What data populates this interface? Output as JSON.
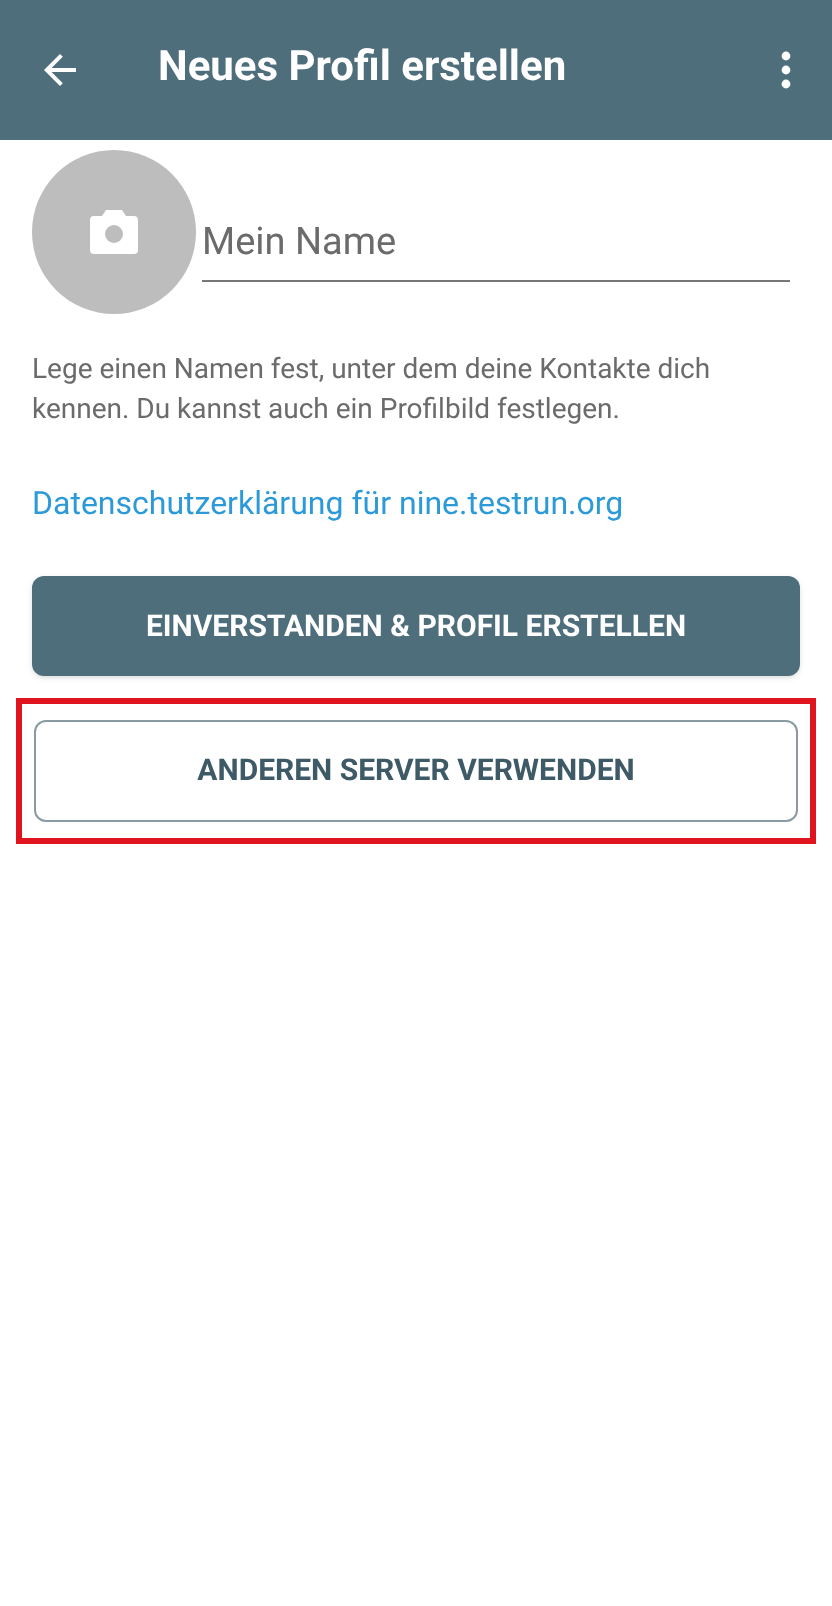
{
  "app_bar": {
    "title": "Neues Profil erstellen"
  },
  "name_field": {
    "placeholder": "Mein Name"
  },
  "description": "Lege einen Namen fest, unter dem deine Kontakte dich kennen. Du kannst auch ein Profilbild festlegen.",
  "privacy_link": "Datenschutzerklärung für nine.testrun.org",
  "buttons": [
    {
      "label": "EINVERSTANDEN & PROFIL ERSTELLEN",
      "kind": "primary",
      "highlighted": false
    },
    {
      "label": "ANDEREN SERVER VERWENDEN",
      "kind": "outline",
      "highlighted": true
    }
  ]
}
